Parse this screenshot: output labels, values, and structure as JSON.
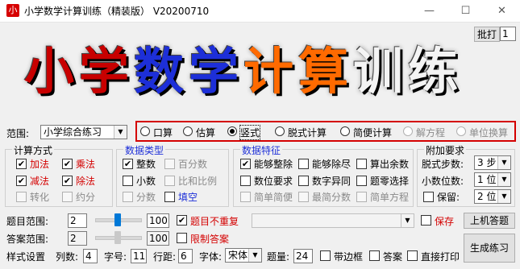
{
  "window": {
    "icon_char": "小",
    "title": "小学数学计算训练（精装版） V20200710",
    "minimize": "—",
    "maximize": "☐",
    "close": "✕"
  },
  "top_right": {
    "batch_button": "批打",
    "batch_value": "1"
  },
  "banner": {
    "chars": [
      "小",
      "学",
      "数",
      "学",
      "计",
      "算",
      "训",
      "练"
    ]
  },
  "scope": {
    "label": "范围:",
    "value": "小学综合练习",
    "types": [
      "口算",
      "估算",
      "竖式",
      "脱式计算",
      "简便计算",
      "解方程",
      "单位换算"
    ],
    "selected": "竖式"
  },
  "calc_method": {
    "title": "计算方式",
    "items": [
      {
        "label": "加法",
        "checked": true,
        "color": "#d40000"
      },
      {
        "label": "乘法",
        "checked": true,
        "color": "#d40000"
      },
      {
        "label": "减法",
        "checked": true,
        "color": "#d40000"
      },
      {
        "label": "除法",
        "checked": true,
        "color": "#d40000"
      },
      {
        "label": "转化",
        "checked": false
      },
      {
        "label": "约分",
        "checked": false
      }
    ]
  },
  "data_type": {
    "title": "数据类型",
    "items": [
      {
        "label": "整数",
        "checked": true
      },
      {
        "label": "百分数",
        "checked": false
      },
      {
        "label": "小数",
        "checked": false
      },
      {
        "label": "比和比例",
        "checked": false
      },
      {
        "label": "分数",
        "checked": false
      },
      {
        "label": "填空",
        "checked": false
      }
    ]
  },
  "data_feature": {
    "title": "数据特征",
    "items": [
      {
        "label": "能够整除",
        "checked": true
      },
      {
        "label": "能够除尽",
        "checked": false
      },
      {
        "label": "算出余数",
        "checked": false
      },
      {
        "label": "数位要求",
        "checked": false
      },
      {
        "label": "数字异同",
        "checked": false
      },
      {
        "label": "题零选择",
        "checked": false
      },
      {
        "label": "简单简便",
        "checked": false
      },
      {
        "label": "最简分数",
        "checked": false
      },
      {
        "label": "简单方程",
        "checked": false
      }
    ]
  },
  "extra": {
    "title": "附加要求",
    "steps_label": "脱式步数:",
    "steps_value": "3 步",
    "decimals_label": "小数位数:",
    "decimals_value": "1 位",
    "keep_label": "保留:",
    "keep_value": "2 位"
  },
  "ranges": {
    "question_label": "题目范围:",
    "question_min": "2",
    "question_max": "100",
    "no_repeat_label": "题目不重复",
    "no_repeat_checked": true,
    "answer_label": "答案范围:",
    "answer_min": "2",
    "answer_max": "100",
    "limit_answer_label": "限制答案",
    "limit_answer_checked": false,
    "save_label": "保存",
    "computer_button": "上机答题"
  },
  "style": {
    "label": "样式设置",
    "columns_label": "列数:",
    "columns_value": "4",
    "fontsize_label": "字号:",
    "fontsize_value": "11",
    "spacing_label": "行距:",
    "spacing_value": "6",
    "font_label": "字体:",
    "font_value": "宋体",
    "count_label": "题量:",
    "count_value": "24",
    "border_label": "带边框",
    "answer_label": "答案",
    "print_label": "直接打印",
    "generate_button": "生成练习"
  }
}
